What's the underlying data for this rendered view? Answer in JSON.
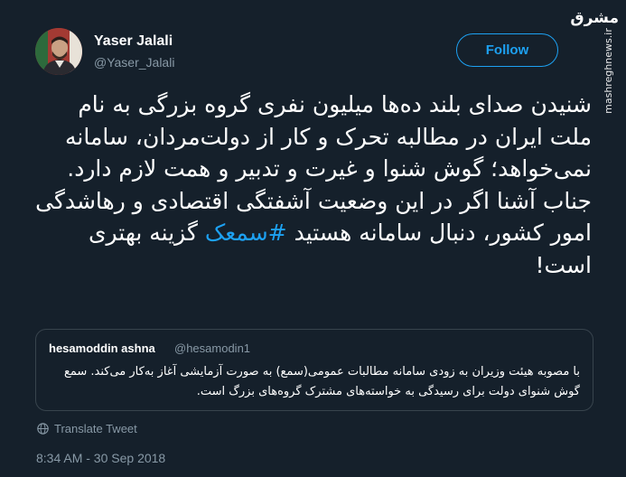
{
  "watermark": {
    "logo": "مشرق",
    "url": "mashreghnews.ir"
  },
  "author": {
    "name": "Yaser Jalali",
    "handle": "@Yaser_Jalali",
    "avatar_icon": "profile-photo"
  },
  "follow_button": {
    "label": "Follow",
    "color": "#1da1f2"
  },
  "tweet": {
    "text_before_hashtag": "شنیدن صدای بلند ده‌ها میلیون نفری گروه بزرگی به نام ملت ایران در مطالبه تحرک و کار از دولت‌مردان، سامانه نمی‌خواهد؛ گوش شنوا و غیرت و تدبیر و همت لازم دارد. جناب آشنا اگر در این وضعیت آشفتگی اقتصادی و رهاشدگی امور کشور، دنبال سامانه هستید ",
    "hashtag": "#سمعک",
    "text_after_hashtag": " گزینه بهتری است!"
  },
  "quoted_tweet": {
    "name": "hesamoddin ashna",
    "handle": "@hesamodin1",
    "text": "با مصوبه هیئت وزیران به زودی سامانه مطالبات عمومی(سمع) به صورت آزمایشی آغاز به‌کار می‌کند. سمع گوش شنوای دولت برای رسیدگی به خواسته‌های مشترک گروه‌های بزرگ است."
  },
  "translate": {
    "label": "Translate Tweet",
    "icon": "globe-icon"
  },
  "timestamp": "8:34 AM - 30 Sep 2018",
  "colors": {
    "background": "#15202b",
    "accent": "#1da1f2",
    "secondary_text": "#8899a6",
    "border": "#38444d"
  }
}
